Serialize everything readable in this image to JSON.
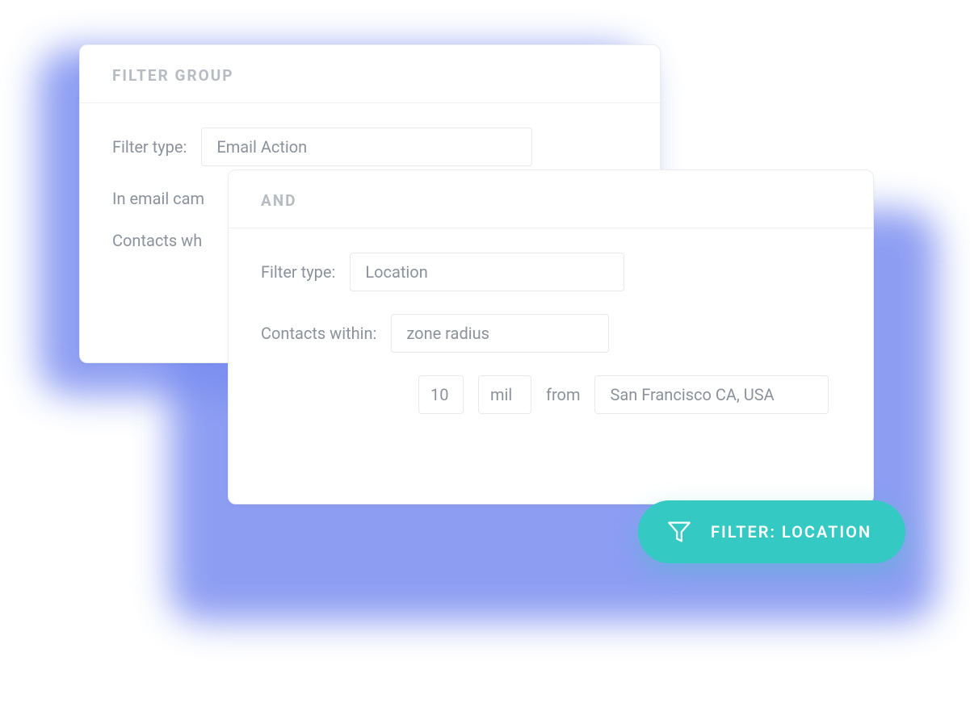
{
  "card1": {
    "title": "FILTER GROUP",
    "filter_type_label": "Filter type:",
    "filter_type_value": "Email Action",
    "line2": "In email cam",
    "line3": "Contacts wh"
  },
  "card2": {
    "title": "AND",
    "filter_type_label": "Filter type:",
    "filter_type_value": "Location",
    "contacts_within_label": "Contacts within:",
    "contacts_within_value": "zone radius",
    "distance_value": "10",
    "distance_unit": "mil",
    "from_label": "from",
    "location_value": "San Francisco CA, USA"
  },
  "pill": {
    "label": "FILTER: LOCATION"
  }
}
